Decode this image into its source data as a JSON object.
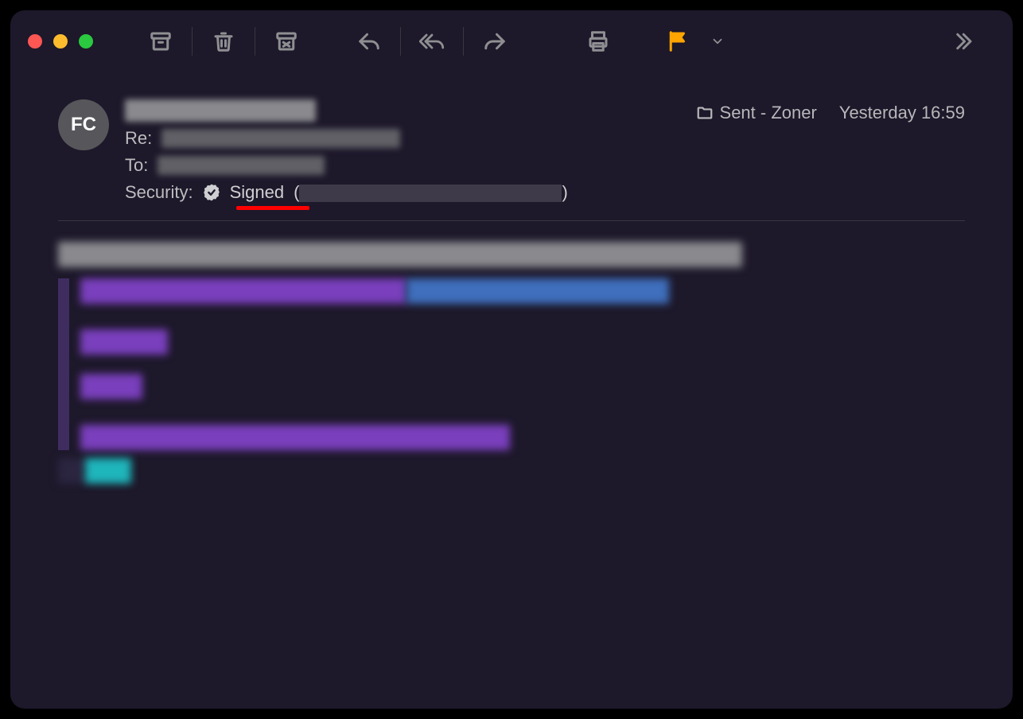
{
  "avatar_initials": "FC",
  "header": {
    "subject_prefix": "Re:",
    "to_label": "To:",
    "security_label": "Security:",
    "security_value": "Signed",
    "security_paren_open": "(",
    "security_paren_close": ")"
  },
  "meta": {
    "folder": "Sent - Zoner",
    "timestamp": "Yesterday 16:59"
  },
  "colors": {
    "window_bg": "#1d182a",
    "flag": "#ffa500",
    "underline": "#ff0000"
  },
  "toolbar_icons": [
    "archive-icon",
    "trash-icon",
    "junk-icon",
    "reply-icon",
    "reply-all-icon",
    "forward-icon",
    "print-icon",
    "flag-icon",
    "flag-menu-icon",
    "overflow-icon"
  ]
}
